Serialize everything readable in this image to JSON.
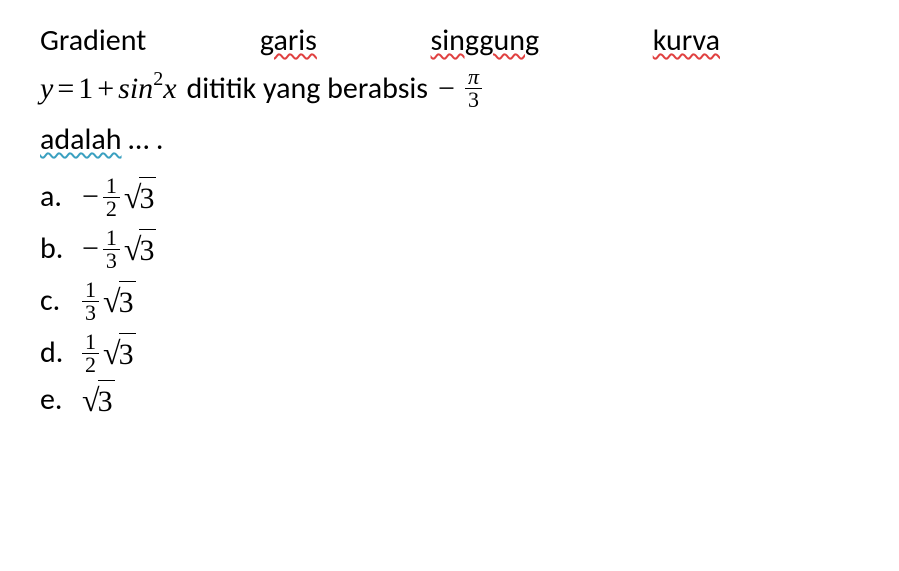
{
  "question": {
    "line1": {
      "w1": "Gradient",
      "w2": "garis",
      "w3": "singgung",
      "w4": "kurva"
    },
    "line2": {
      "eq_y": "y",
      "eq_equals": "=",
      "eq_one": "1",
      "eq_plus": "+",
      "eq_sin": "sin",
      "eq_exp": "2",
      "eq_x": "x",
      "text1": "dititik yang berabsis",
      "minus": "−",
      "frac_num": "π",
      "frac_den": "3"
    },
    "line3": {
      "w1": "adalah",
      "dots": "… ."
    }
  },
  "options": {
    "a": {
      "label": "a.",
      "minus": "−",
      "frac_num": "1",
      "frac_den": "2",
      "radical": "√",
      "radicand": "3"
    },
    "b": {
      "label": "b.",
      "minus": "−",
      "frac_num": "1",
      "frac_den": "3",
      "radical": "√",
      "radicand": "3"
    },
    "c": {
      "label": "c.",
      "frac_num": "1",
      "frac_den": "3",
      "radical": "√",
      "radicand": "3"
    },
    "d": {
      "label": "d.",
      "frac_num": "1",
      "frac_den": "2",
      "radical": "√",
      "radicand": "3"
    },
    "e": {
      "label": "e.",
      "radical": "√",
      "radicand": "3"
    }
  }
}
